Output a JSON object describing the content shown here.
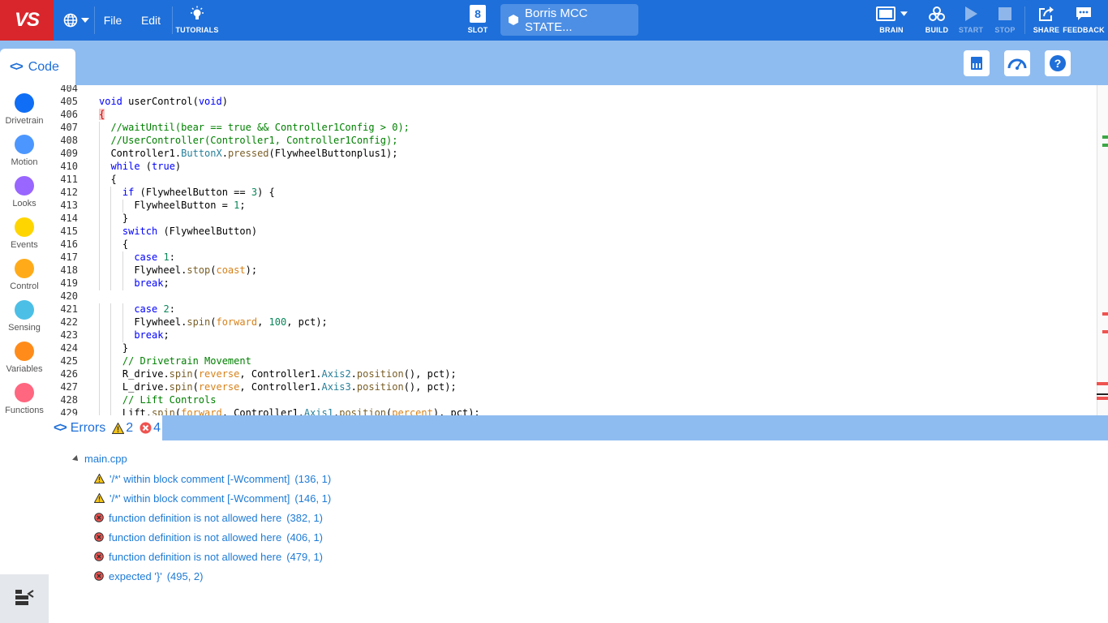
{
  "topbar": {
    "logo": "VS",
    "file_label": "File",
    "edit_label": "Edit",
    "tutorials_label": "TUTORIALS",
    "slot_number": "8",
    "slot_label": "SLOT",
    "project_name": "Borris MCC STATE...",
    "brain_label": "BRAIN",
    "build_label": "BUILD",
    "start_label": "START",
    "stop_label": "STOP",
    "share_label": "SHARE",
    "feedback_label": "FEEDBACK"
  },
  "subbar": {
    "code_tab_label": "Code"
  },
  "sidebar": {
    "categories": [
      {
        "name": "Drivetrain",
        "color": "#0f6ef5"
      },
      {
        "name": "Motion",
        "color": "#4c97ff"
      },
      {
        "name": "Looks",
        "color": "#9966ff"
      },
      {
        "name": "Events",
        "color": "#ffd500"
      },
      {
        "name": "Control",
        "color": "#ffab19"
      },
      {
        "name": "Sensing",
        "color": "#4cbfe6"
      },
      {
        "name": "Variables",
        "color": "#ff8c1a"
      },
      {
        "name": "Functions",
        "color": "#ff6680"
      }
    ]
  },
  "editor": {
    "lines": [
      {
        "n": "404",
        "indent": 0,
        "tokens": []
      },
      {
        "n": "405",
        "indent": 0,
        "tokens": [
          [
            "kw",
            "void"
          ],
          [
            "t",
            " userControl("
          ],
          [
            "kw",
            "void"
          ],
          [
            "t",
            ")"
          ]
        ]
      },
      {
        "n": "406",
        "indent": 0,
        "tokens": [
          [
            "hl",
            "{"
          ]
        ]
      },
      {
        "n": "407",
        "indent": 1,
        "tokens": [
          [
            "cm",
            "//waitUntil(bear == true && Controller1Config > 0);"
          ]
        ]
      },
      {
        "n": "408",
        "indent": 1,
        "tokens": [
          [
            "cm",
            "//UserController(Controller1, Controller1Config);"
          ]
        ]
      },
      {
        "n": "409",
        "indent": 1,
        "tokens": [
          [
            "t",
            "Controller1."
          ],
          [
            "mem",
            "ButtonX"
          ],
          [
            "t",
            "."
          ],
          [
            "fn",
            "pressed"
          ],
          [
            "t",
            "(FlywheelButtonplus1);"
          ]
        ]
      },
      {
        "n": "410",
        "indent": 1,
        "tokens": [
          [
            "kw",
            "while"
          ],
          [
            "t",
            " ("
          ],
          [
            "kw",
            "true"
          ],
          [
            "t",
            ")"
          ]
        ]
      },
      {
        "n": "411",
        "indent": 1,
        "tokens": [
          [
            "t",
            "{"
          ]
        ]
      },
      {
        "n": "412",
        "indent": 2,
        "tokens": [
          [
            "kw",
            "if"
          ],
          [
            "t",
            " (FlywheelButton == "
          ],
          [
            "num",
            "3"
          ],
          [
            "t",
            ") {"
          ]
        ]
      },
      {
        "n": "413",
        "indent": 3,
        "tokens": [
          [
            "t",
            "FlywheelButton = "
          ],
          [
            "num",
            "1"
          ],
          [
            "t",
            ";"
          ]
        ]
      },
      {
        "n": "414",
        "indent": 2,
        "tokens": [
          [
            "t",
            "}"
          ]
        ]
      },
      {
        "n": "415",
        "indent": 2,
        "tokens": [
          [
            "kw",
            "switch"
          ],
          [
            "t",
            " (FlywheelButton)"
          ]
        ]
      },
      {
        "n": "416",
        "indent": 2,
        "tokens": [
          [
            "t",
            "{"
          ]
        ]
      },
      {
        "n": "417",
        "indent": 3,
        "tokens": [
          [
            "kw",
            "case"
          ],
          [
            "t",
            " "
          ],
          [
            "num",
            "1"
          ],
          [
            "t",
            ":"
          ]
        ]
      },
      {
        "n": "418",
        "indent": 3,
        "tokens": [
          [
            "t",
            "Flywheel."
          ],
          [
            "fn",
            "stop"
          ],
          [
            "t",
            "("
          ],
          [
            "en",
            "coast"
          ],
          [
            "t",
            ");"
          ]
        ]
      },
      {
        "n": "419",
        "indent": 3,
        "tokens": [
          [
            "kw",
            "break"
          ],
          [
            "t",
            ";"
          ]
        ]
      },
      {
        "n": "420",
        "indent": 0,
        "tokens": []
      },
      {
        "n": "421",
        "indent": 3,
        "tokens": [
          [
            "kw",
            "case"
          ],
          [
            "t",
            " "
          ],
          [
            "num",
            "2"
          ],
          [
            "t",
            ":"
          ]
        ]
      },
      {
        "n": "422",
        "indent": 3,
        "tokens": [
          [
            "t",
            "Flywheel."
          ],
          [
            "fn",
            "spin"
          ],
          [
            "t",
            "("
          ],
          [
            "en",
            "forward"
          ],
          [
            "t",
            ", "
          ],
          [
            "num",
            "100"
          ],
          [
            "t",
            ", pct);"
          ]
        ]
      },
      {
        "n": "423",
        "indent": 3,
        "tokens": [
          [
            "kw",
            "break"
          ],
          [
            "t",
            ";"
          ]
        ]
      },
      {
        "n": "424",
        "indent": 2,
        "tokens": [
          [
            "t",
            "}"
          ]
        ]
      },
      {
        "n": "425",
        "indent": 2,
        "tokens": [
          [
            "cm",
            "// Drivetrain Movement"
          ]
        ]
      },
      {
        "n": "426",
        "indent": 2,
        "tokens": [
          [
            "t",
            "R_drive."
          ],
          [
            "fn",
            "spin"
          ],
          [
            "t",
            "("
          ],
          [
            "en",
            "reverse"
          ],
          [
            "t",
            ", Controller1."
          ],
          [
            "mem",
            "Axis2"
          ],
          [
            "t",
            "."
          ],
          [
            "fn",
            "position"
          ],
          [
            "t",
            "(), pct);"
          ]
        ]
      },
      {
        "n": "427",
        "indent": 2,
        "tokens": [
          [
            "t",
            "L_drive."
          ],
          [
            "fn",
            "spin"
          ],
          [
            "t",
            "("
          ],
          [
            "en",
            "reverse"
          ],
          [
            "t",
            ", Controller1."
          ],
          [
            "mem",
            "Axis3"
          ],
          [
            "t",
            "."
          ],
          [
            "fn",
            "position"
          ],
          [
            "t",
            "(), pct);"
          ]
        ]
      },
      {
        "n": "428",
        "indent": 2,
        "tokens": [
          [
            "cm",
            "// Lift Controls"
          ]
        ]
      },
      {
        "n": "429",
        "indent": 2,
        "tokens": [
          [
            "t",
            "Lift."
          ],
          [
            "fn",
            "spin"
          ],
          [
            "t",
            "("
          ],
          [
            "en",
            "forward"
          ],
          [
            "t",
            ", Controller1."
          ],
          [
            "mem",
            "Axis1"
          ],
          [
            "t",
            "."
          ],
          [
            "fn",
            "position"
          ],
          [
            "t",
            "("
          ],
          [
            "en",
            "percent"
          ],
          [
            "t",
            "), pct);"
          ]
        ]
      }
    ]
  },
  "errors": {
    "tab_label": "Errors",
    "warning_count": "2",
    "error_count": "4",
    "file_name": "main.cpp",
    "items": [
      {
        "type": "warning",
        "message": "'/*' within block comment [-Wcomment]",
        "location": "(136, 1)"
      },
      {
        "type": "warning",
        "message": "'/*' within block comment [-Wcomment]",
        "location": "(146, 1)"
      },
      {
        "type": "error",
        "message": "function definition is not allowed here",
        "location": "(382, 1)"
      },
      {
        "type": "error",
        "message": "function definition is not allowed here",
        "location": "(406, 1)"
      },
      {
        "type": "error",
        "message": "function definition is not allowed here",
        "location": "(479, 1)"
      },
      {
        "type": "error",
        "message": "expected '}'",
        "location": "(495, 2)"
      }
    ]
  }
}
